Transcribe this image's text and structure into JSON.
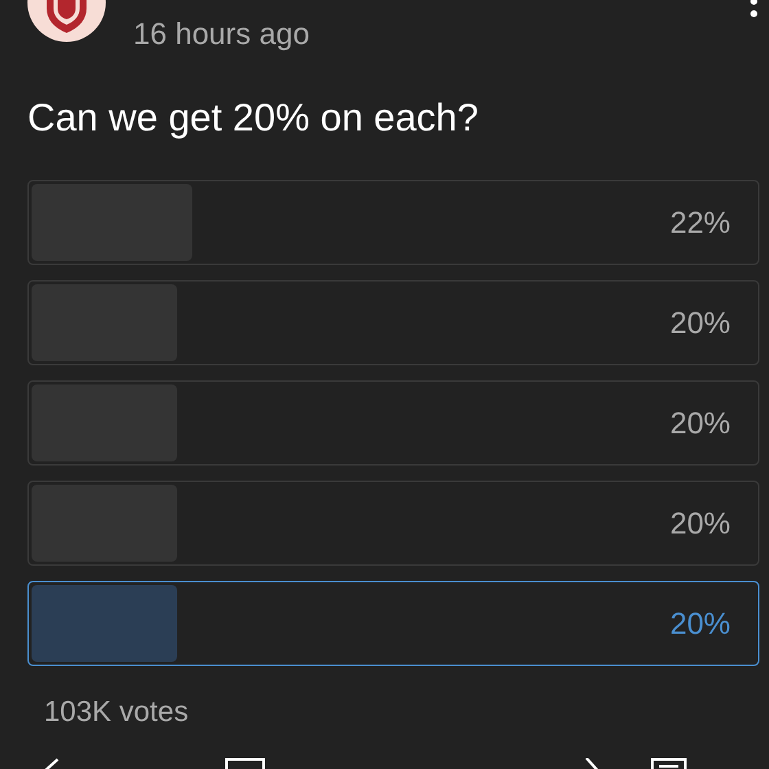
{
  "post": {
    "time": "16 hours ago",
    "question": "Can we get 20% on each?"
  },
  "options": [
    {
      "percent": "22%",
      "level": 0.22,
      "selected": false
    },
    {
      "percent": "20%",
      "level": 0.2,
      "selected": false
    },
    {
      "percent": "20%",
      "level": 0.2,
      "selected": false
    },
    {
      "percent": "20%",
      "level": 0.2,
      "selected": false
    },
    {
      "percent": "20%",
      "level": 0.2,
      "selected": true
    }
  ],
  "votes": "103K votes"
}
